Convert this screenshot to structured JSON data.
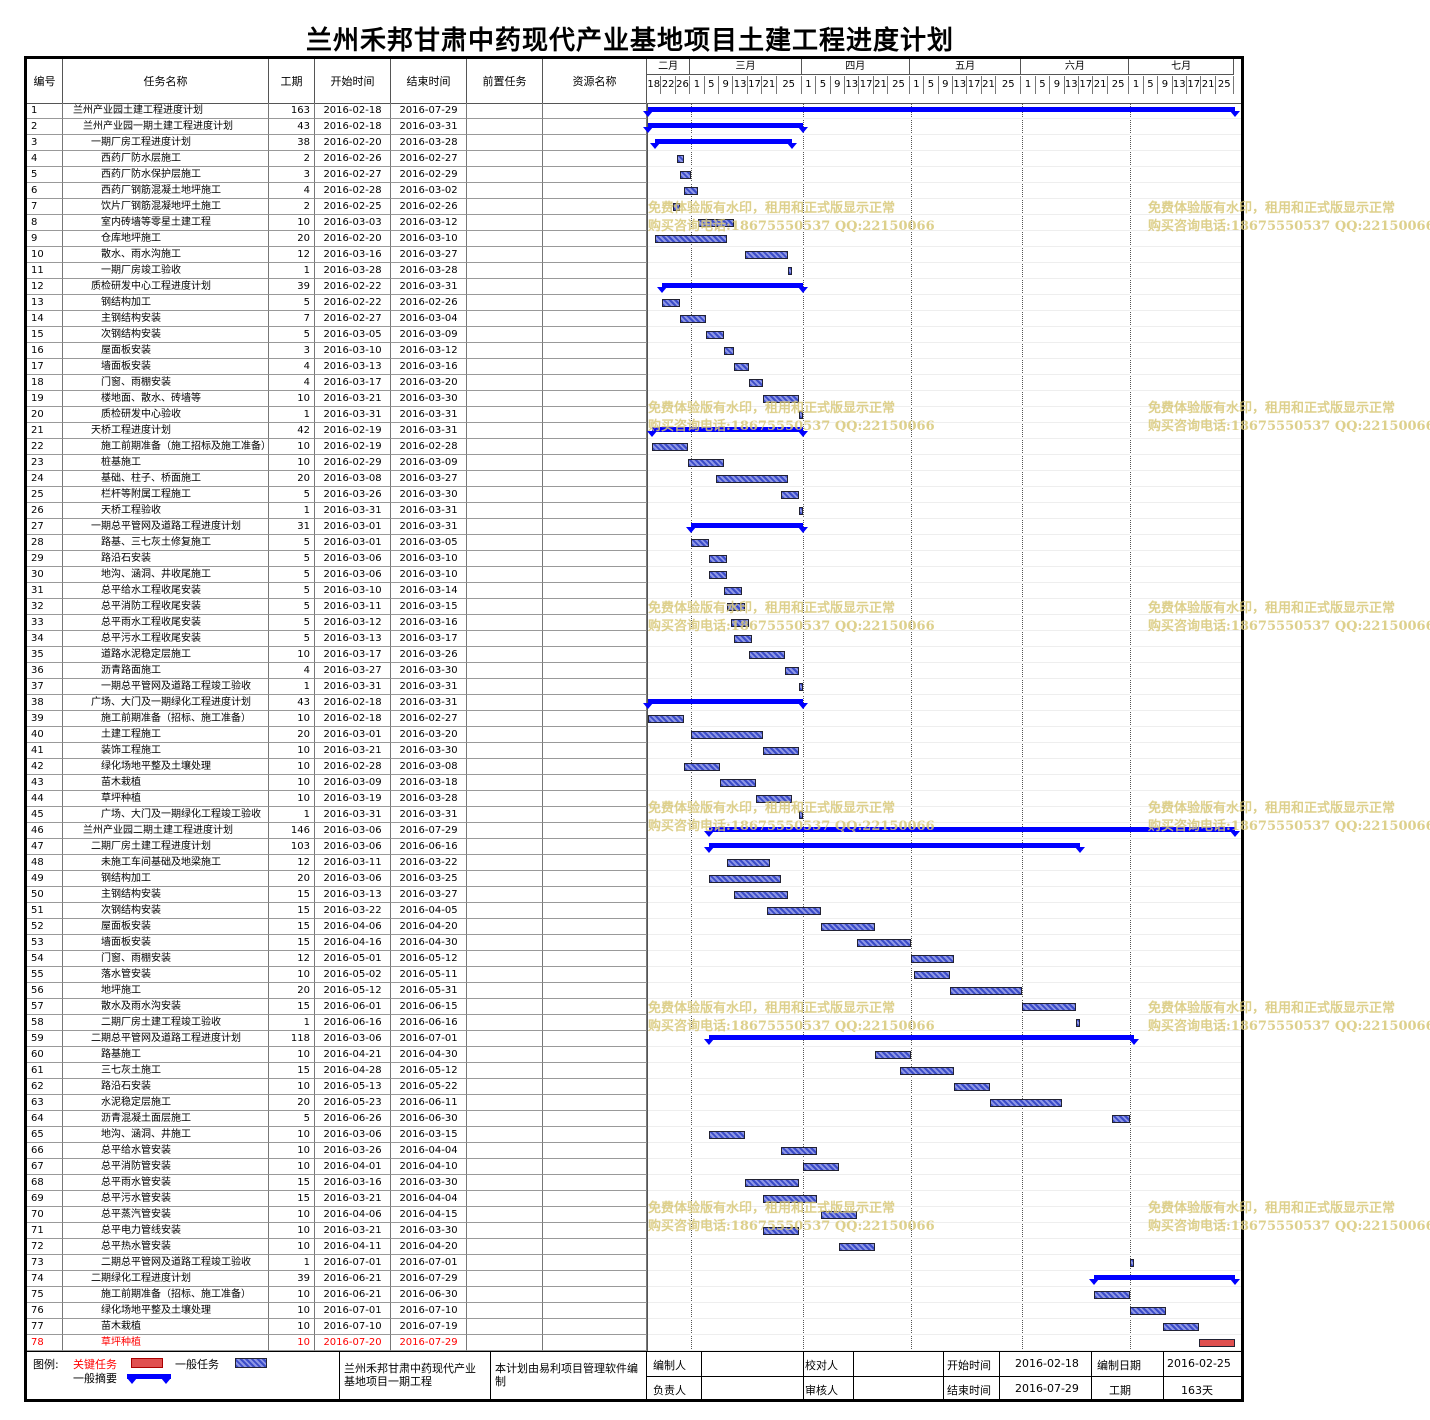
{
  "title": "兰州禾邦甘肃中药现代产业基地项目土建工程进度计划",
  "columns": {
    "id": "编号",
    "name": "任务名称",
    "duration": "工期",
    "start": "开始时间",
    "end": "结束时间",
    "predecessor": "前置任务",
    "resource": "资源名称"
  },
  "timeline": {
    "start": "2016-02-18",
    "end": "2016-07-29",
    "months": [
      {
        "label": "二月",
        "start": "2016-02-18",
        "end": "2016-02-29"
      },
      {
        "label": "三月",
        "start": "2016-03-01",
        "end": "2016-03-31"
      },
      {
        "label": "四月",
        "start": "2016-04-01",
        "end": "2016-04-30"
      },
      {
        "label": "五月",
        "start": "2016-05-01",
        "end": "2016-05-31"
      },
      {
        "label": "六月",
        "start": "2016-06-01",
        "end": "2016-06-30"
      },
      {
        "label": "七月",
        "start": "2016-07-01",
        "end": "2016-07-29"
      }
    ],
    "day_ticks": [
      {
        "label": "18",
        "date": "2016-02-18"
      },
      {
        "label": "22",
        "date": "2016-02-22"
      },
      {
        "label": "26",
        "date": "2016-02-26"
      },
      {
        "label": "1",
        "date": "2016-03-01"
      },
      {
        "label": "5",
        "date": "2016-03-05"
      },
      {
        "label": "9",
        "date": "2016-03-09"
      },
      {
        "label": "13",
        "date": "2016-03-13"
      },
      {
        "label": "17",
        "date": "2016-03-17"
      },
      {
        "label": "21",
        "date": "2016-03-21"
      },
      {
        "label": "25",
        "date": "2016-03-25"
      },
      {
        "label": "1",
        "date": "2016-04-01"
      },
      {
        "label": "5",
        "date": "2016-04-05"
      },
      {
        "label": "9",
        "date": "2016-04-09"
      },
      {
        "label": "13",
        "date": "2016-04-13"
      },
      {
        "label": "17",
        "date": "2016-04-17"
      },
      {
        "label": "21",
        "date": "2016-04-21"
      },
      {
        "label": "25",
        "date": "2016-04-25"
      },
      {
        "label": "1",
        "date": "2016-05-01"
      },
      {
        "label": "5",
        "date": "2016-05-05"
      },
      {
        "label": "9",
        "date": "2016-05-09"
      },
      {
        "label": "13",
        "date": "2016-05-13"
      },
      {
        "label": "17",
        "date": "2016-05-17"
      },
      {
        "label": "21",
        "date": "2016-05-21"
      },
      {
        "label": "25",
        "date": "2016-05-25"
      },
      {
        "label": "1",
        "date": "2016-06-01"
      },
      {
        "label": "5",
        "date": "2016-06-05"
      },
      {
        "label": "9",
        "date": "2016-06-09"
      },
      {
        "label": "13",
        "date": "2016-06-13"
      },
      {
        "label": "17",
        "date": "2016-06-17"
      },
      {
        "label": "21",
        "date": "2016-06-21"
      },
      {
        "label": "25",
        "date": "2016-06-25"
      },
      {
        "label": "1",
        "date": "2016-07-01"
      },
      {
        "label": "5",
        "date": "2016-07-05"
      },
      {
        "label": "9",
        "date": "2016-07-09"
      },
      {
        "label": "13",
        "date": "2016-07-13"
      },
      {
        "label": "17",
        "date": "2016-07-17"
      },
      {
        "label": "21",
        "date": "2016-07-21"
      },
      {
        "label": "25",
        "date": "2016-07-25"
      }
    ]
  },
  "chart_data": {
    "type": "gantt",
    "tasks": [
      {
        "id": "1",
        "name": "兰州产业园土建工程进度计划",
        "duration": "163",
        "start": "2016-02-18",
        "end": "2016-07-29",
        "kind": "summary",
        "level": 1
      },
      {
        "id": "2",
        "name": "兰州产业园一期土建工程进度计划",
        "duration": "43",
        "start": "2016-02-18",
        "end": "2016-03-31",
        "kind": "summary",
        "level": 2
      },
      {
        "id": "3",
        "name": "一期厂房工程进度计划",
        "duration": "38",
        "start": "2016-02-20",
        "end": "2016-03-28",
        "kind": "summary",
        "level": 3
      },
      {
        "id": "4",
        "name": "西药厂防水层施工",
        "duration": "2",
        "start": "2016-02-26",
        "end": "2016-02-27",
        "kind": "task",
        "level": 4
      },
      {
        "id": "5",
        "name": "西药厂防水保护层施工",
        "duration": "3",
        "start": "2016-02-27",
        "end": "2016-02-29",
        "kind": "task",
        "level": 4
      },
      {
        "id": "6",
        "name": "西药厂钢筋混凝土地坪施工",
        "duration": "4",
        "start": "2016-02-28",
        "end": "2016-03-02",
        "kind": "task",
        "level": 4
      },
      {
        "id": "7",
        "name": "饮片厂钢筋混凝地坪土施工",
        "duration": "2",
        "start": "2016-02-25",
        "end": "2016-02-26",
        "kind": "task",
        "level": 4
      },
      {
        "id": "8",
        "name": "室内砖墙等零星土建工程",
        "duration": "10",
        "start": "2016-03-03",
        "end": "2016-03-12",
        "kind": "task",
        "level": 4
      },
      {
        "id": "9",
        "name": "仓库地坪施工",
        "duration": "20",
        "start": "2016-02-20",
        "end": "2016-03-10",
        "kind": "task",
        "level": 4
      },
      {
        "id": "10",
        "name": "散水、雨水沟施工",
        "duration": "12",
        "start": "2016-03-16",
        "end": "2016-03-27",
        "kind": "task",
        "level": 4
      },
      {
        "id": "11",
        "name": "一期厂房竣工验收",
        "duration": "1",
        "start": "2016-03-28",
        "end": "2016-03-28",
        "kind": "task",
        "level": 4
      },
      {
        "id": "12",
        "name": "质检研发中心工程进度计划",
        "duration": "39",
        "start": "2016-02-22",
        "end": "2016-03-31",
        "kind": "summary",
        "level": 3
      },
      {
        "id": "13",
        "name": "钢结构加工",
        "duration": "5",
        "start": "2016-02-22",
        "end": "2016-02-26",
        "kind": "task",
        "level": 4
      },
      {
        "id": "14",
        "name": "主钢结构安装",
        "duration": "7",
        "start": "2016-02-27",
        "end": "2016-03-04",
        "kind": "task",
        "level": 4
      },
      {
        "id": "15",
        "name": "次钢结构安装",
        "duration": "5",
        "start": "2016-03-05",
        "end": "2016-03-09",
        "kind": "task",
        "level": 4
      },
      {
        "id": "16",
        "name": "屋面板安装",
        "duration": "3",
        "start": "2016-03-10",
        "end": "2016-03-12",
        "kind": "task",
        "level": 4
      },
      {
        "id": "17",
        "name": "墙面板安装",
        "duration": "4",
        "start": "2016-03-13",
        "end": "2016-03-16",
        "kind": "task",
        "level": 4
      },
      {
        "id": "18",
        "name": "门窗、雨棚安装",
        "duration": "4",
        "start": "2016-03-17",
        "end": "2016-03-20",
        "kind": "task",
        "level": 4
      },
      {
        "id": "19",
        "name": "楼地面、散水、砖墙等",
        "duration": "10",
        "start": "2016-03-21",
        "end": "2016-03-30",
        "kind": "task",
        "level": 4
      },
      {
        "id": "20",
        "name": "质检研发中心验收",
        "duration": "1",
        "start": "2016-03-31",
        "end": "2016-03-31",
        "kind": "task",
        "level": 4
      },
      {
        "id": "21",
        "name": "天桥工程进度计划",
        "duration": "42",
        "start": "2016-02-19",
        "end": "2016-03-31",
        "kind": "summary",
        "level": 3
      },
      {
        "id": "22",
        "name": "施工前期准备（施工招标及施工准备）",
        "duration": "10",
        "start": "2016-02-19",
        "end": "2016-02-28",
        "kind": "task",
        "level": 4
      },
      {
        "id": "23",
        "name": "桩基施工",
        "duration": "10",
        "start": "2016-02-29",
        "end": "2016-03-09",
        "kind": "task",
        "level": 4
      },
      {
        "id": "24",
        "name": "基础、柱子、桥面施工",
        "duration": "20",
        "start": "2016-03-08",
        "end": "2016-03-27",
        "kind": "task",
        "level": 4
      },
      {
        "id": "25",
        "name": "栏杆等附属工程施工",
        "duration": "5",
        "start": "2016-03-26",
        "end": "2016-03-30",
        "kind": "task",
        "level": 4
      },
      {
        "id": "26",
        "name": "天桥工程验收",
        "duration": "1",
        "start": "2016-03-31",
        "end": "2016-03-31",
        "kind": "task",
        "level": 4
      },
      {
        "id": "27",
        "name": "一期总平管网及道路工程进度计划",
        "duration": "31",
        "start": "2016-03-01",
        "end": "2016-03-31",
        "kind": "summary",
        "level": 3
      },
      {
        "id": "28",
        "name": "路基、三七灰土修复施工",
        "duration": "5",
        "start": "2016-03-01",
        "end": "2016-03-05",
        "kind": "task",
        "level": 4
      },
      {
        "id": "29",
        "name": "路沿石安装",
        "duration": "5",
        "start": "2016-03-06",
        "end": "2016-03-10",
        "kind": "task",
        "level": 4
      },
      {
        "id": "30",
        "name": "地沟、涵洞、井收尾施工",
        "duration": "5",
        "start": "2016-03-06",
        "end": "2016-03-10",
        "kind": "task",
        "level": 4
      },
      {
        "id": "31",
        "name": "总平给水工程收尾安装",
        "duration": "5",
        "start": "2016-03-10",
        "end": "2016-03-14",
        "kind": "task",
        "level": 4
      },
      {
        "id": "32",
        "name": "总平消防工程收尾安装",
        "duration": "5",
        "start": "2016-03-11",
        "end": "2016-03-15",
        "kind": "task",
        "level": 4
      },
      {
        "id": "33",
        "name": "总平雨水工程收尾安装",
        "duration": "5",
        "start": "2016-03-12",
        "end": "2016-03-16",
        "kind": "task",
        "level": 4
      },
      {
        "id": "34",
        "name": "总平污水工程收尾安装",
        "duration": "5",
        "start": "2016-03-13",
        "end": "2016-03-17",
        "kind": "task",
        "level": 4
      },
      {
        "id": "35",
        "name": "道路水泥稳定层施工",
        "duration": "10",
        "start": "2016-03-17",
        "end": "2016-03-26",
        "kind": "task",
        "level": 4
      },
      {
        "id": "36",
        "name": "沥青路面施工",
        "duration": "4",
        "start": "2016-03-27",
        "end": "2016-03-30",
        "kind": "task",
        "level": 4
      },
      {
        "id": "37",
        "name": "一期总平管网及道路工程竣工验收",
        "duration": "1",
        "start": "2016-03-31",
        "end": "2016-03-31",
        "kind": "task",
        "level": 4
      },
      {
        "id": "38",
        "name": "广场、大门及一期绿化工程进度计划",
        "duration": "43",
        "start": "2016-02-18",
        "end": "2016-03-31",
        "kind": "summary",
        "level": 3
      },
      {
        "id": "39",
        "name": "施工前期准备（招标、施工准备）",
        "duration": "10",
        "start": "2016-02-18",
        "end": "2016-02-27",
        "kind": "task",
        "level": 4
      },
      {
        "id": "40",
        "name": "土建工程施工",
        "duration": "20",
        "start": "2016-03-01",
        "end": "2016-03-20",
        "kind": "task",
        "level": 4
      },
      {
        "id": "41",
        "name": "装饰工程施工",
        "duration": "10",
        "start": "2016-03-21",
        "end": "2016-03-30",
        "kind": "task",
        "level": 4
      },
      {
        "id": "42",
        "name": "绿化场地平整及土壤处理",
        "duration": "10",
        "start": "2016-02-28",
        "end": "2016-03-08",
        "kind": "task",
        "level": 4
      },
      {
        "id": "43",
        "name": "苗木栽植",
        "duration": "10",
        "start": "2016-03-09",
        "end": "2016-03-18",
        "kind": "task",
        "level": 4
      },
      {
        "id": "44",
        "name": "草坪种植",
        "duration": "10",
        "start": "2016-03-19",
        "end": "2016-03-28",
        "kind": "task",
        "level": 4
      },
      {
        "id": "45",
        "name": "广场、大门及一期绿化工程竣工验收",
        "duration": "1",
        "start": "2016-03-31",
        "end": "2016-03-31",
        "kind": "task",
        "level": 4
      },
      {
        "id": "46",
        "name": "兰州产业园二期土建工程进度计划",
        "duration": "146",
        "start": "2016-03-06",
        "end": "2016-07-29",
        "kind": "summary",
        "level": 2
      },
      {
        "id": "47",
        "name": "二期厂房土建工程进度计划",
        "duration": "103",
        "start": "2016-03-06",
        "end": "2016-06-16",
        "kind": "summary",
        "level": 3
      },
      {
        "id": "48",
        "name": "未施工车间基础及地梁施工",
        "duration": "12",
        "start": "2016-03-11",
        "end": "2016-03-22",
        "kind": "task",
        "level": 4
      },
      {
        "id": "49",
        "name": "钢结构加工",
        "duration": "20",
        "start": "2016-03-06",
        "end": "2016-03-25",
        "kind": "task",
        "level": 4
      },
      {
        "id": "50",
        "name": "主钢结构安装",
        "duration": "15",
        "start": "2016-03-13",
        "end": "2016-03-27",
        "kind": "task",
        "level": 4
      },
      {
        "id": "51",
        "name": "次钢结构安装",
        "duration": "15",
        "start": "2016-03-22",
        "end": "2016-04-05",
        "kind": "task",
        "level": 4
      },
      {
        "id": "52",
        "name": "屋面板安装",
        "duration": "15",
        "start": "2016-04-06",
        "end": "2016-04-20",
        "kind": "task",
        "level": 4
      },
      {
        "id": "53",
        "name": "墙面板安装",
        "duration": "15",
        "start": "2016-04-16",
        "end": "2016-04-30",
        "kind": "task",
        "level": 4
      },
      {
        "id": "54",
        "name": "门窗、雨棚安装",
        "duration": "12",
        "start": "2016-05-01",
        "end": "2016-05-12",
        "kind": "task",
        "level": 4
      },
      {
        "id": "55",
        "name": "落水管安装",
        "duration": "10",
        "start": "2016-05-02",
        "end": "2016-05-11",
        "kind": "task",
        "level": 4
      },
      {
        "id": "56",
        "name": "地坪施工",
        "duration": "20",
        "start": "2016-05-12",
        "end": "2016-05-31",
        "kind": "task",
        "level": 4
      },
      {
        "id": "57",
        "name": "散水及雨水沟安装",
        "duration": "15",
        "start": "2016-06-01",
        "end": "2016-06-15",
        "kind": "task",
        "level": 4
      },
      {
        "id": "58",
        "name": "二期厂房土建工程竣工验收",
        "duration": "1",
        "start": "2016-06-16",
        "end": "2016-06-16",
        "kind": "task",
        "level": 4
      },
      {
        "id": "59",
        "name": "二期总平管网及道路工程进度计划",
        "duration": "118",
        "start": "2016-03-06",
        "end": "2016-07-01",
        "kind": "summary",
        "level": 3
      },
      {
        "id": "60",
        "name": "路基施工",
        "duration": "10",
        "start": "2016-04-21",
        "end": "2016-04-30",
        "kind": "task",
        "level": 4
      },
      {
        "id": "61",
        "name": "三七灰土施工",
        "duration": "15",
        "start": "2016-04-28",
        "end": "2016-05-12",
        "kind": "task",
        "level": 4
      },
      {
        "id": "62",
        "name": "路沿石安装",
        "duration": "10",
        "start": "2016-05-13",
        "end": "2016-05-22",
        "kind": "task",
        "level": 4
      },
      {
        "id": "63",
        "name": "水泥稳定层施工",
        "duration": "20",
        "start": "2016-05-23",
        "end": "2016-06-11",
        "kind": "task",
        "level": 4
      },
      {
        "id": "64",
        "name": "沥青混凝土面层施工",
        "duration": "5",
        "start": "2016-06-26",
        "end": "2016-06-30",
        "kind": "task",
        "level": 4
      },
      {
        "id": "65",
        "name": "地沟、涵洞、井施工",
        "duration": "10",
        "start": "2016-03-06",
        "end": "2016-03-15",
        "kind": "task",
        "level": 4
      },
      {
        "id": "66",
        "name": "总平给水管安装",
        "duration": "10",
        "start": "2016-03-26",
        "end": "2016-04-04",
        "kind": "task",
        "level": 4
      },
      {
        "id": "67",
        "name": "总平消防管安装",
        "duration": "10",
        "start": "2016-04-01",
        "end": "2016-04-10",
        "kind": "task",
        "level": 4
      },
      {
        "id": "68",
        "name": "总平雨水管安装",
        "duration": "15",
        "start": "2016-03-16",
        "end": "2016-03-30",
        "kind": "task",
        "level": 4
      },
      {
        "id": "69",
        "name": "总平污水管安装",
        "duration": "15",
        "start": "2016-03-21",
        "end": "2016-04-04",
        "kind": "task",
        "level": 4
      },
      {
        "id": "70",
        "name": "总平蒸汽管安装",
        "duration": "10",
        "start": "2016-04-06",
        "end": "2016-04-15",
        "kind": "task",
        "level": 4
      },
      {
        "id": "71",
        "name": "总平电力管线安装",
        "duration": "10",
        "start": "2016-03-21",
        "end": "2016-03-30",
        "kind": "task",
        "level": 4
      },
      {
        "id": "72",
        "name": "总平热水管安装",
        "duration": "10",
        "start": "2016-04-11",
        "end": "2016-04-20",
        "kind": "task",
        "level": 4
      },
      {
        "id": "73",
        "name": "二期总平管网及道路工程竣工验收",
        "duration": "1",
        "start": "2016-07-01",
        "end": "2016-07-01",
        "kind": "task",
        "level": 4
      },
      {
        "id": "74",
        "name": "二期绿化工程进度计划",
        "duration": "39",
        "start": "2016-06-21",
        "end": "2016-07-29",
        "kind": "summary",
        "level": 3
      },
      {
        "id": "75",
        "name": "施工前期准备（招标、施工准备）",
        "duration": "10",
        "start": "2016-06-21",
        "end": "2016-06-30",
        "kind": "task",
        "level": 4
      },
      {
        "id": "76",
        "name": "绿化场地平整及土壤处理",
        "duration": "10",
        "start": "2016-07-01",
        "end": "2016-07-10",
        "kind": "task",
        "level": 4
      },
      {
        "id": "77",
        "name": "苗木栽植",
        "duration": "10",
        "start": "2016-07-10",
        "end": "2016-07-19",
        "kind": "task",
        "level": 4
      },
      {
        "id": "78",
        "name": "草坪种植",
        "duration": "10",
        "start": "2016-07-20",
        "end": "2016-07-29",
        "kind": "critical",
        "level": 4
      }
    ]
  },
  "legend": {
    "label": "图例:",
    "critical": "关键任务",
    "normal": "一般任务",
    "summary": "一般摘要"
  },
  "footer": {
    "project": "兰州禾邦甘肃中药现代产业基地项目一期工程",
    "note": "本计划由易利项目管理软件编制",
    "compiler_label": "编制人",
    "checker_label": "校对人",
    "start_label": "开始时间",
    "start_value": "2016-02-18",
    "date_label": "编制日期",
    "date_value": "2016-02-25",
    "owner_label": "负责人",
    "reviewer_label": "审核人",
    "end_label": "结束时间",
    "end_value": "2016-07-29",
    "duration_label": "工期",
    "duration_value": "163天"
  },
  "watermark": {
    "line1": "免费体验版有水印，租用和正式版显示正常",
    "line2": "购买咨询电话:18675550537 QQ:22150066"
  },
  "colors": {
    "task": "#3b4cc8",
    "summary": "#0000ff",
    "critical": "#e05050",
    "critical_text": "#ff0000"
  }
}
